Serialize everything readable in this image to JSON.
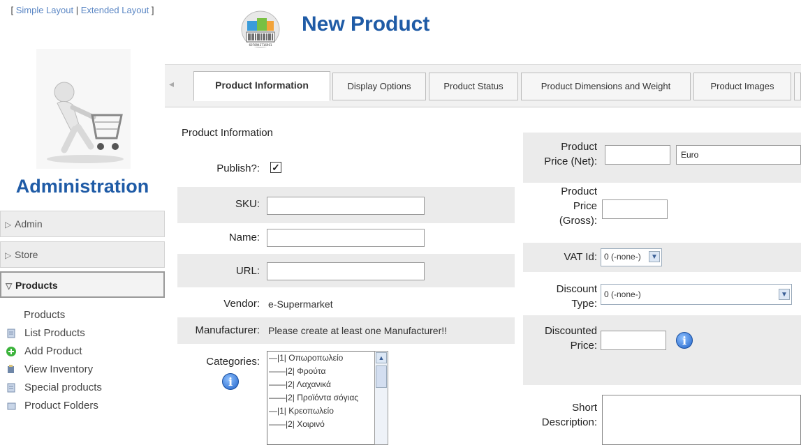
{
  "sidebar": {
    "layout_links": {
      "open": "[ ",
      "simple": "Simple Layout",
      "sep": " | ",
      "extended": "Extended Layout",
      "close": " ]"
    },
    "admin_title": "Administration",
    "menu": [
      {
        "label": "Admin"
      },
      {
        "label": "Store"
      },
      {
        "label": "Products"
      }
    ],
    "products_heading": "Products",
    "items": [
      {
        "label": "List Products",
        "icon": "list-icon"
      },
      {
        "label": "Add Product",
        "icon": "add-icon"
      },
      {
        "label": "View Inventory",
        "icon": "inventory-icon"
      },
      {
        "label": "Special products",
        "icon": "special-icon"
      },
      {
        "label": "Product Folders",
        "icon": "folder-icon"
      }
    ]
  },
  "header": {
    "title": "New Product",
    "barcode_number": "6078943716901"
  },
  "tabs": [
    {
      "label": "Product Information"
    },
    {
      "label": "Display Options"
    },
    {
      "label": "Product Status"
    },
    {
      "label": "Product Dimensions and Weight"
    },
    {
      "label": "Product Images"
    }
  ],
  "form": {
    "section_title": "Product Information",
    "publish_label": "Publish?:",
    "publish_checked": "✓",
    "sku_label": "SKU:",
    "name_label": "Name:",
    "url_label": "URL:",
    "vendor_label": "Vendor:",
    "vendor_value": "e-Supermarket",
    "manufacturer_label": "Manufacturer:",
    "manufacturer_value": "Please create at least one Manufacturer!!",
    "categories_label": "Categories:",
    "categories": [
      "—|1| Οπωροπωλείο",
      "——|2| Φρούτα",
      "——|2| Λαχανικά",
      "——|2| Προϊόντα σόγιας",
      "—|1| Κρεοπωλείο",
      "——|2| Χοιρινό"
    ],
    "price_net_label": "Product Price (Net):",
    "price_net_line1": "Product",
    "price_net_line2": "Price (Net):",
    "currency": "Euro",
    "price_gross_line1": "Product",
    "price_gross_line2": "Price",
    "price_gross_line3": "(Gross):",
    "vat_label": "VAT Id:",
    "vat_value": "0 (-none-)",
    "discount_type_line1": "Discount",
    "discount_type_line2": "Type:",
    "discount_type_value": "0 (-none-)",
    "discounted_price_line1": "Discounted",
    "discounted_price_line2": "Price:",
    "short_desc_line1": "Short",
    "short_desc_line2": "Description:"
  },
  "colors": {
    "accent": "#1f5ba6",
    "link": "#5a86c4",
    "row_bg": "#ebebeb"
  }
}
